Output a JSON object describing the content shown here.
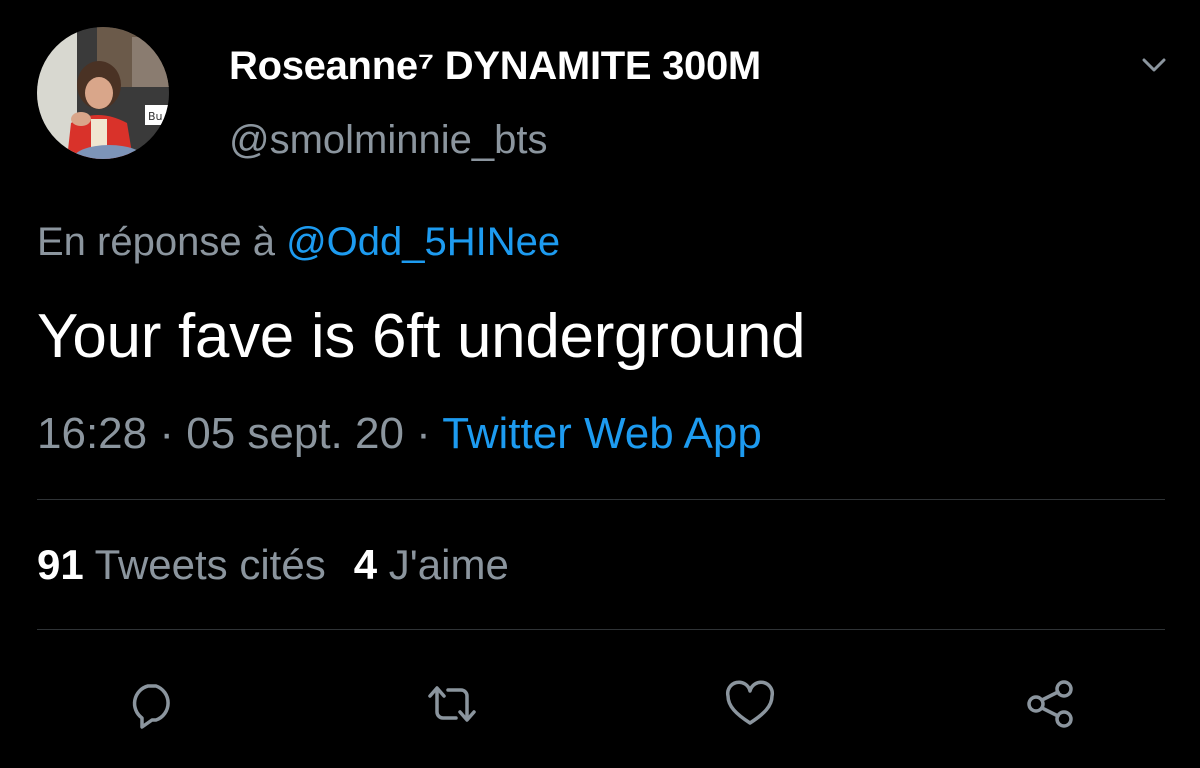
{
  "author": {
    "display_name": "Roseanne⁷ DYNAMITE 300M",
    "handle": "@smolminnie_bts",
    "avatar_icon": "profile-photo"
  },
  "reply_context": {
    "prefix": "En réponse à ",
    "mention": "@Odd_5HINee"
  },
  "tweet": {
    "text": "Your fave is 6ft underground"
  },
  "meta": {
    "time": "16:28",
    "separator": " · ",
    "date": "05 sept. 20",
    "source": "Twitter Web App"
  },
  "stats": {
    "quote_count": "91",
    "quote_label": " Tweets cités",
    "like_count": "4",
    "like_label": " J'aime"
  },
  "actions": [
    "reply-icon",
    "retweet-icon",
    "like-icon",
    "share-icon"
  ],
  "colors": {
    "background": "#000000",
    "text_primary": "#ffffff",
    "text_secondary": "#8b959e",
    "accent": "#1d9bf0",
    "divider": "#2f3336"
  }
}
